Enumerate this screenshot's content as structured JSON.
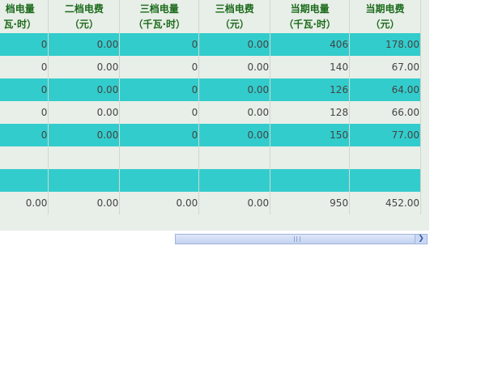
{
  "columns": [
    {
      "line1": "档电量",
      "line2": "瓦·时）"
    },
    {
      "line1": "二档电费",
      "line2": "（元）"
    },
    {
      "line1": "三档电量",
      "line2": "（千瓦·时）"
    },
    {
      "line1": "三档电费",
      "line2": "（元）"
    },
    {
      "line1": "当期电量",
      "line2": "（千瓦·时）"
    },
    {
      "line1": "当期电费",
      "line2": "（元）"
    }
  ],
  "rows": [
    [
      "0",
      "0.00",
      "0",
      "0.00",
      "406",
      "178.00"
    ],
    [
      "0",
      "0.00",
      "0",
      "0.00",
      "140",
      "67.00"
    ],
    [
      "0",
      "0.00",
      "0",
      "0.00",
      "126",
      "64.00"
    ],
    [
      "0",
      "0.00",
      "0",
      "0.00",
      "128",
      "66.00"
    ],
    [
      "0",
      "0.00",
      "0",
      "0.00",
      "150",
      "77.00"
    ],
    [
      "",
      "",
      "",
      "",
      "",
      ""
    ],
    [
      "",
      "",
      "",
      "",
      "",
      ""
    ],
    [
      "0.00",
      "0.00",
      "0.00",
      "0.00",
      "950",
      "452.00"
    ]
  ],
  "scrollbar": {
    "right_arrow_icon": "chevron-right-icon"
  }
}
